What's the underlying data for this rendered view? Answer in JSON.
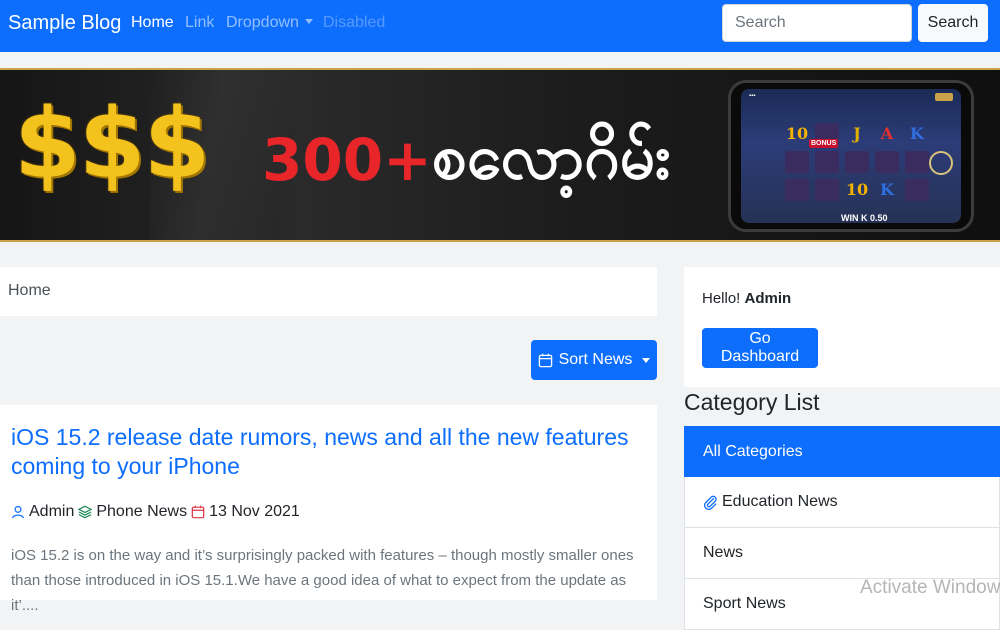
{
  "navbar": {
    "brand": "Sample Blog",
    "links": [
      {
        "label": "Home",
        "state": "active"
      },
      {
        "label": "Link",
        "state": "normal"
      },
      {
        "label": "Dropdown",
        "state": "normal"
      },
      {
        "label": "Disabled",
        "state": "disabled"
      }
    ],
    "search_placeholder": "Search",
    "search_button": "Search"
  },
  "banner": {
    "symbols": "$$$",
    "count_text": "300+",
    "burmese_text": "စလော့ဂိမ်း",
    "slot_win_text": "WIN  K 0.50",
    "slot_bonus_text": "BONUS",
    "reel_symbols": [
      "10",
      "",
      "J",
      "A",
      "K",
      "",
      "",
      "",
      "",
      "",
      "",
      "",
      "10",
      "K",
      ""
    ]
  },
  "breadcrumb": {
    "home": "Home"
  },
  "sort": {
    "label": "Sort News",
    "icon": "calendar-icon"
  },
  "article": {
    "title": "iOS 15.2 release date rumors, news and all the new features coming to your iPhone",
    "author": "Admin",
    "category": "Phone News",
    "date": "13 Nov 2021",
    "excerpt": "iOS 15.2 is on the way and it’s surprisingly packed with features – though mostly smaller ones than those introduced in iOS 15.1.We have a good idea of what to expect from the update as it’...."
  },
  "sidebar": {
    "greeting_prefix": "Hello! ",
    "greeting_name": "Admin",
    "dashboard_button": "Go Dashboard",
    "category_heading": "Category List",
    "categories": [
      {
        "label": "All Categories",
        "active": true,
        "icon": ""
      },
      {
        "label": "Education News",
        "active": false,
        "icon": "paperclip-icon"
      },
      {
        "label": "News",
        "active": false,
        "icon": ""
      },
      {
        "label": "Sport News",
        "active": false,
        "icon": ""
      }
    ]
  },
  "watermark": "Activate Windows",
  "colors": {
    "primary": "#0d6efd",
    "link_muted": "rgba(255,255,255,0.55)",
    "banner_gold": "#f3c21c",
    "banner_red": "#e8262a",
    "date_icon": "#dc3545",
    "category_icon": "#198754"
  }
}
